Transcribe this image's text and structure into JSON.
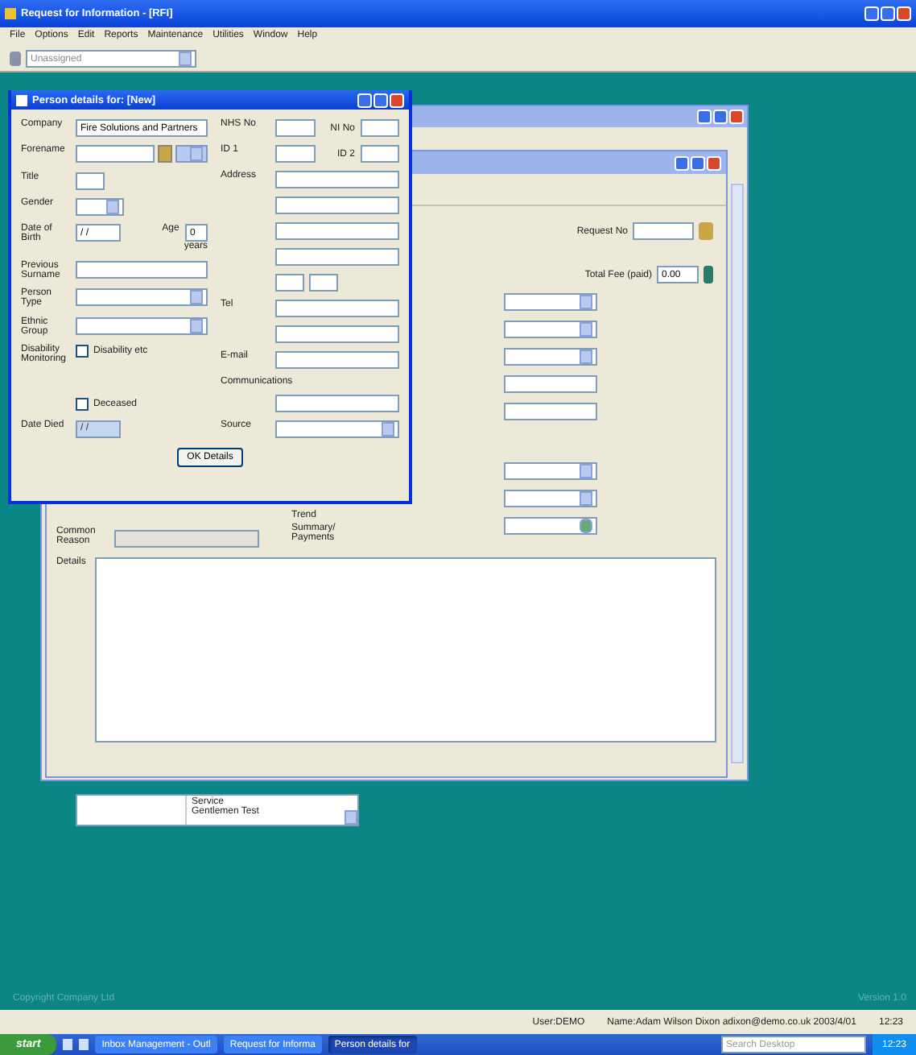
{
  "app": {
    "title": "Request for Information - [RFI]",
    "menu": [
      "File",
      "Options",
      "Edit",
      "Reports",
      "Maintenance",
      "Utilities",
      "Window",
      "Help"
    ],
    "toolbar_value": "Unassigned"
  },
  "person_dialog": {
    "title": "Person details for: [New]",
    "left": [
      {
        "kind": "text",
        "label": "Company",
        "value": "Fire Solutions and Partners"
      },
      {
        "kind": "lookup",
        "label": "Forename"
      },
      {
        "kind": "short",
        "label": "Title"
      },
      {
        "kind": "combo",
        "label": "Gender"
      },
      {
        "kind": "dob",
        "label": "Date of Birth",
        "value": "/ /",
        "age_label": "Age",
        "age": "0",
        "age_unit": "years"
      },
      {
        "kind": "text",
        "label": "Previous Surname"
      },
      {
        "kind": "combo",
        "label": "Person Type"
      },
      {
        "kind": "combo",
        "label": "Ethnic Group"
      },
      {
        "kind": "check",
        "label": "Disability Monitoring",
        "text": "Disability etc",
        "checked": false
      },
      {
        "kind": "check",
        "text": "Deceased",
        "checked": false
      },
      {
        "kind": "date",
        "label": "Date Died",
        "value": "/ /",
        "disabled": true
      }
    ],
    "right": [
      {
        "kind": "pair",
        "label": "NHS No",
        "label2": "NI No"
      },
      {
        "kind": "pair",
        "label": "ID 1",
        "label2": "ID 2"
      },
      {
        "kind": "text",
        "label": "Address"
      },
      {
        "kind": "text"
      },
      {
        "kind": "text"
      },
      {
        "kind": "text"
      },
      {
        "kind": "postcode"
      },
      {
        "kind": "text",
        "label": "Tel"
      },
      {
        "kind": "text"
      },
      {
        "kind": "text",
        "label": "E-mail"
      },
      {
        "kind": "heading",
        "label": "Communications"
      },
      {
        "kind": "text"
      },
      {
        "kind": "combo",
        "label": "Source"
      }
    ],
    "button": "OK Details"
  },
  "request_form": {
    "request_no_label": "Request No",
    "fee_label": "Total Fee (paid)",
    "fee_value": "0.00",
    "fields": [
      {
        "kind": "combo"
      },
      {
        "kind": "combo"
      },
      {
        "kind": "combo"
      },
      {
        "kind": "text"
      },
      {
        "kind": "text"
      },
      {
        "kind": "gap"
      },
      {
        "kind": "combo"
      },
      {
        "kind": "combo"
      },
      {
        "kind": "lookup"
      }
    ],
    "reason_label": "Common Reason",
    "trend_label": "Trend",
    "summary_label": "Summary/ Payments",
    "details_label": "Details"
  },
  "service_box": {
    "label": "Service",
    "value": "Gentlemen Test"
  },
  "desktop": {
    "copyright": "Copyright Company Ltd",
    "version": "Version 1.0"
  },
  "status_bar": [
    "User:DEMO",
    "Name:Adam Wilson Dixon adixon@demo.co.uk 2003/4/01",
    "12:23"
  ],
  "taskbar": {
    "start": "start",
    "tasks": [
      {
        "label": "Inbox Management - Outl",
        "selected": false
      },
      {
        "label": "Request for Informa",
        "selected": false
      },
      {
        "label": "Person details for",
        "selected": true
      }
    ],
    "search": "Search Desktop",
    "clock": "12:23"
  }
}
